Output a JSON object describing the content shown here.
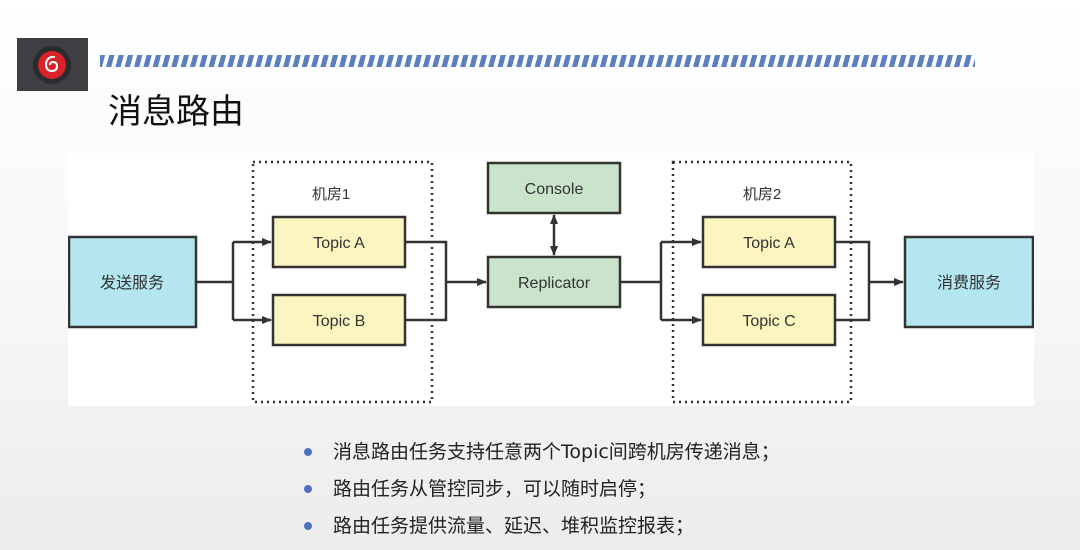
{
  "header": {
    "title": "消息路由",
    "logo": "netease-cloud-music-logo",
    "accent": "#5b7fbf"
  },
  "diagram": {
    "sender": "发送服务",
    "room1": {
      "label": "机房1",
      "topics": [
        "Topic A",
        "Topic B"
      ]
    },
    "console": "Console",
    "replicator": "Replicator",
    "room2": {
      "label": "机房2",
      "topics": [
        "Topic A",
        "Topic C"
      ]
    },
    "consumer": "消费服务",
    "colors": {
      "service": "#b3e6ee",
      "topic": "#fbf5c0",
      "control": "#c9e4cb"
    }
  },
  "bullets": [
    "消息路由任务支持任意两个Topic间跨机房传递消息；",
    "路由任务从管控同步，可以随时启停；",
    "路由任务提供流量、延迟、堆积监控报表；"
  ]
}
